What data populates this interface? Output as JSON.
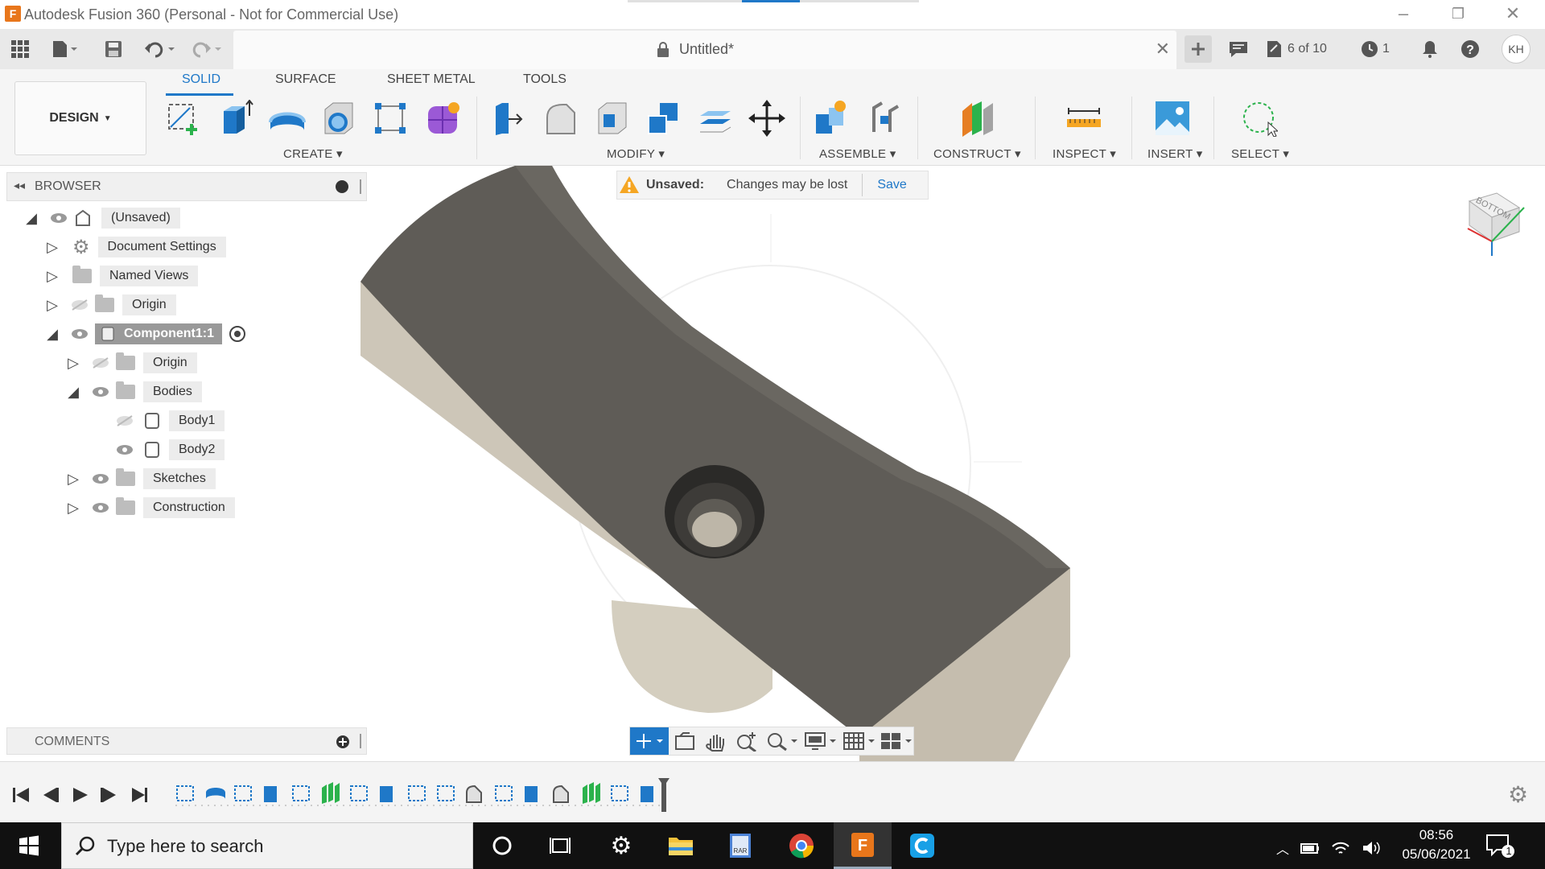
{
  "app": {
    "title": "Autodesk Fusion 360 (Personal - Not for Commercial Use)",
    "logo_letter": "F"
  },
  "header": {
    "doc_title": "Untitled*",
    "jobs": "6 of 10",
    "clock_count": "1",
    "avatar": "KH"
  },
  "workspace_tabs": [
    "SOLID",
    "SURFACE",
    "SHEET METAL",
    "TOOLS"
  ],
  "design_button": "DESIGN",
  "toolbar_groups": {
    "create": "CREATE",
    "modify": "MODIFY",
    "assemble": "ASSEMBLE",
    "construct": "CONSTRUCT",
    "inspect": "INSPECT",
    "insert": "INSERT",
    "select": "SELECT"
  },
  "browser": {
    "title": "BROWSER",
    "items": [
      {
        "label": "(Unsaved)",
        "icon": "document-icon"
      },
      {
        "label": "Document Settings",
        "icon": "gear-icon"
      },
      {
        "label": "Named Views",
        "icon": "folder-icon"
      },
      {
        "label": "Origin",
        "icon": "folder-icon"
      },
      {
        "label": "Component1:1",
        "icon": "component-icon"
      },
      {
        "label": "Origin",
        "icon": "folder-icon"
      },
      {
        "label": "Bodies",
        "icon": "folder-icon"
      },
      {
        "label": "Body1",
        "icon": "body-icon"
      },
      {
        "label": "Body2",
        "icon": "body-icon"
      },
      {
        "label": "Sketches",
        "icon": "folder-icon"
      },
      {
        "label": "Construction",
        "icon": "folder-icon"
      }
    ]
  },
  "comments": {
    "title": "COMMENTS"
  },
  "notice": {
    "label": "Unsaved:",
    "message": "Changes may be lost",
    "save": "Save"
  },
  "viewcube": {
    "face": "BOTTOM"
  },
  "taskbar": {
    "search_placeholder": "Type here to search",
    "time": "08:56",
    "date": "05/06/2021",
    "notification_count": "1"
  },
  "colors": {
    "accent": "#1f78c8",
    "part_top": "#5f5c57",
    "part_side": "#cdc6b8",
    "taskbar": "#111111"
  }
}
